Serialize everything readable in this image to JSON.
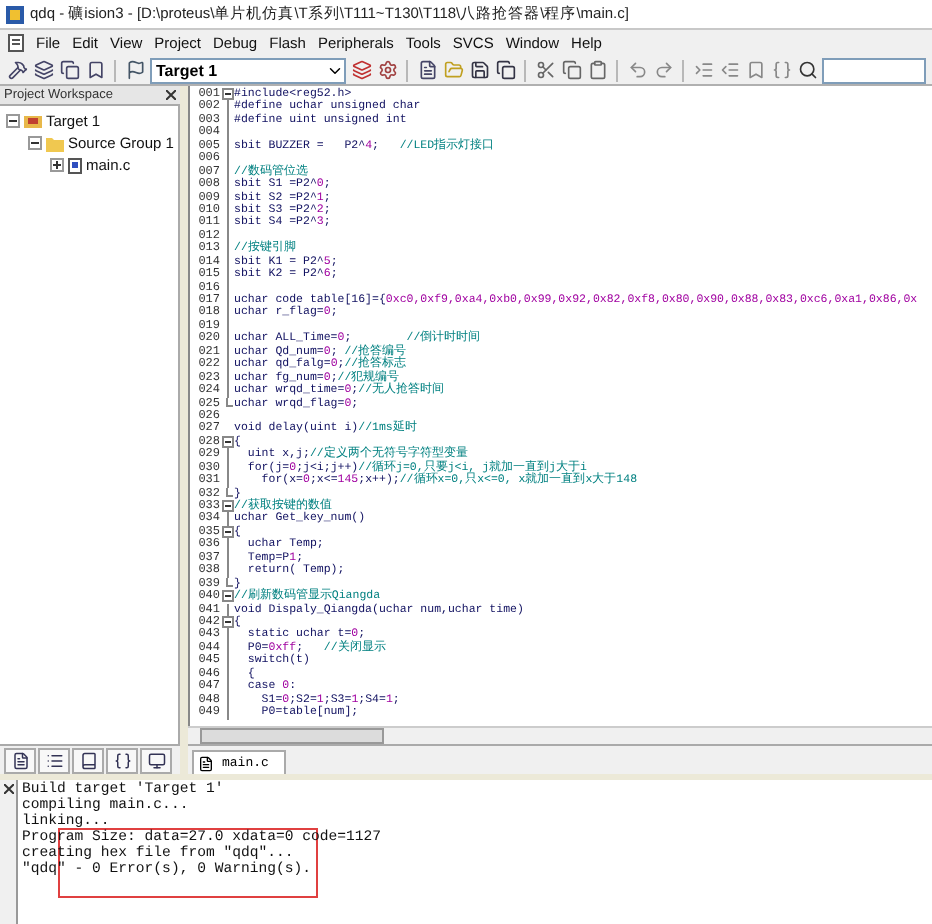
{
  "window": {
    "title": "qdq - 礦ision3 - [D:\\proteus\\单片机仿真\\T系列\\T111~T130\\T118\\八路抢答器\\程序\\main.c]"
  },
  "menu": [
    "File",
    "Edit",
    "View",
    "Project",
    "Debug",
    "Flash",
    "Peripherals",
    "Tools",
    "SVCS",
    "Window",
    "Help"
  ],
  "toolbar": {
    "target": "Target 1"
  },
  "workspace": {
    "title": "Project Workspace",
    "tree": [
      {
        "label": "Target 1",
        "kind": "target",
        "expanded": true,
        "children": [
          {
            "label": "Source Group 1",
            "kind": "group",
            "expanded": true,
            "children": [
              {
                "label": "main.c",
                "kind": "file",
                "expanded": false
              }
            ]
          }
        ]
      }
    ]
  },
  "editor": {
    "tabs": [
      {
        "label": "main.c",
        "selected": true
      }
    ],
    "lines": [
      {
        "no": "001",
        "kind": "open",
        "parts": [
          {
            "kind": "code",
            "text": "#include<reg52.h>"
          }
        ]
      },
      {
        "no": "002",
        "kind": "inner",
        "parts": [
          {
            "kind": "code",
            "text": "#define uchar unsigned char"
          }
        ]
      },
      {
        "no": "003",
        "kind": "inner",
        "parts": [
          {
            "kind": "code",
            "text": "#define uint unsigned int"
          }
        ]
      },
      {
        "no": "004",
        "kind": "inner"
      },
      {
        "no": "005",
        "kind": "inner",
        "parts": [
          {
            "kind": "code",
            "text": "sbit BUZZER =   P2^"
          },
          {
            "kind": "number",
            "text": "4"
          },
          {
            "kind": "code",
            "text": ";   "
          },
          {
            "kind": "comment",
            "text": "//LED指示灯接口"
          }
        ]
      },
      {
        "no": "006",
        "kind": "inner"
      },
      {
        "no": "007",
        "kind": "inner",
        "parts": [
          {
            "kind": "comment",
            "text": "//数码管位选"
          }
        ]
      },
      {
        "no": "008",
        "kind": "inner",
        "parts": [
          {
            "kind": "code",
            "text": "sbit S1 =P2^"
          },
          {
            "kind": "number",
            "text": "0"
          },
          {
            "kind": "code",
            "text": ";"
          }
        ]
      },
      {
        "no": "009",
        "kind": "inner",
        "parts": [
          {
            "kind": "code",
            "text": "sbit S2 =P2^"
          },
          {
            "kind": "number",
            "text": "1"
          },
          {
            "kind": "code",
            "text": ";"
          }
        ]
      },
      {
        "no": "010",
        "kind": "inner",
        "parts": [
          {
            "kind": "code",
            "text": "sbit S3 =P2^"
          },
          {
            "kind": "number",
            "text": "2"
          },
          {
            "kind": "code",
            "text": ";"
          }
        ]
      },
      {
        "no": "011",
        "kind": "inner",
        "parts": [
          {
            "kind": "code",
            "text": "sbit S4 =P2^"
          },
          {
            "kind": "number",
            "text": "3"
          },
          {
            "kind": "code",
            "text": ";"
          }
        ]
      },
      {
        "no": "012",
        "kind": "inner"
      },
      {
        "no": "013",
        "kind": "inner",
        "parts": [
          {
            "kind": "comment",
            "text": "//按键引脚"
          }
        ]
      },
      {
        "no": "014",
        "kind": "inner",
        "parts": [
          {
            "kind": "code",
            "text": "sbit K1 = P2^"
          },
          {
            "kind": "number",
            "text": "5"
          },
          {
            "kind": "code",
            "text": ";"
          }
        ]
      },
      {
        "no": "015",
        "kind": "inner",
        "parts": [
          {
            "kind": "code",
            "text": "sbit K2 = P2^"
          },
          {
            "kind": "number",
            "text": "6"
          },
          {
            "kind": "code",
            "text": ";"
          }
        ]
      },
      {
        "no": "016",
        "kind": "inner"
      },
      {
        "no": "017",
        "kind": "inner",
        "parts": [
          {
            "kind": "code",
            "text": "uchar code table[16]={"
          },
          {
            "kind": "number",
            "text": "0xc0,0xf9,0xa4,0xb0,0x99,0x92,0x82,0xf8,0x80,0x90,0x88,0x83,0xc6,0xa1,0x86,0x"
          }
        ]
      },
      {
        "no": "018",
        "kind": "inner",
        "parts": [
          {
            "kind": "code",
            "text": "uchar r_flag="
          },
          {
            "kind": "number",
            "text": "0"
          },
          {
            "kind": "code",
            "text": ";"
          }
        ]
      },
      {
        "no": "019",
        "kind": "inner"
      },
      {
        "no": "020",
        "kind": "inner",
        "parts": [
          {
            "kind": "code",
            "text": "uchar ALL_Time="
          },
          {
            "kind": "number",
            "text": "0"
          },
          {
            "kind": "code",
            "text": ";        "
          },
          {
            "kind": "comment",
            "text": "//倒计时时间"
          }
        ]
      },
      {
        "no": "021",
        "kind": "inner",
        "parts": [
          {
            "kind": "code",
            "text": "uchar Qd_num="
          },
          {
            "kind": "number",
            "text": "0"
          },
          {
            "kind": "code",
            "text": "; "
          },
          {
            "kind": "comment",
            "text": "//抢答编号"
          }
        ]
      },
      {
        "no": "022",
        "kind": "inner",
        "parts": [
          {
            "kind": "code",
            "text": "uchar qd_falg="
          },
          {
            "kind": "number",
            "text": "0"
          },
          {
            "kind": "code",
            "text": ";"
          },
          {
            "kind": "comment",
            "text": "//抢答标志"
          }
        ]
      },
      {
        "no": "023",
        "kind": "inner",
        "parts": [
          {
            "kind": "code",
            "text": "uchar fg_num="
          },
          {
            "kind": "number",
            "text": "0"
          },
          {
            "kind": "code",
            "text": ";"
          },
          {
            "kind": "comment",
            "text": "//犯规编号"
          }
        ]
      },
      {
        "no": "024",
        "kind": "inner",
        "parts": [
          {
            "kind": "code",
            "text": "uchar wrqd_time="
          },
          {
            "kind": "number",
            "text": "0"
          },
          {
            "kind": "code",
            "text": ";"
          },
          {
            "kind": "comment",
            "text": "//无人抢答时间"
          }
        ]
      },
      {
        "no": "025",
        "kind": "close",
        "parts": [
          {
            "kind": "code",
            "text": "uchar wrqd_flag="
          },
          {
            "kind": "number",
            "text": "0"
          },
          {
            "kind": "code",
            "text": ";"
          }
        ]
      },
      {
        "no": "026",
        "kind": "plain"
      },
      {
        "no": "027",
        "kind": "plain",
        "parts": [
          {
            "kind": "code",
            "text": "void delay(uint i)"
          },
          {
            "kind": "comment",
            "text": "//1ms延时"
          }
        ]
      },
      {
        "no": "028",
        "kind": "open",
        "parts": [
          {
            "kind": "code",
            "text": "{"
          }
        ]
      },
      {
        "no": "029",
        "kind": "inner",
        "parts": [
          {
            "kind": "code",
            "text": "  uint x,j;"
          },
          {
            "kind": "comment",
            "text": "//定义两个无符号字符型变量"
          }
        ]
      },
      {
        "no": "030",
        "kind": "inner",
        "parts": [
          {
            "kind": "code",
            "text": "  for(j="
          },
          {
            "kind": "number",
            "text": "0"
          },
          {
            "kind": "code",
            "text": ";j<i;j++)"
          },
          {
            "kind": "comment",
            "text": "//循环j=0,只要j<i, j就加一直到j大于i"
          }
        ]
      },
      {
        "no": "031",
        "kind": "inner",
        "parts": [
          {
            "kind": "code",
            "text": "    for(x="
          },
          {
            "kind": "number",
            "text": "0"
          },
          {
            "kind": "code",
            "text": ";x<="
          },
          {
            "kind": "number",
            "text": "145"
          },
          {
            "kind": "code",
            "text": ";x++);"
          },
          {
            "kind": "comment",
            "text": "//循环x=0,只x<=0, x就加一直到x大于148"
          }
        ]
      },
      {
        "no": "032",
        "kind": "close",
        "parts": [
          {
            "kind": "code",
            "text": "}"
          }
        ]
      },
      {
        "no": "033",
        "kind": "open",
        "parts": [
          {
            "kind": "comment",
            "text": "//获取按键的数值"
          }
        ]
      },
      {
        "no": "034",
        "kind": "inner",
        "parts": [
          {
            "kind": "code",
            "text": "uchar Get_key_num()"
          }
        ]
      },
      {
        "no": "035",
        "kind": "open",
        "parts": [
          {
            "kind": "code",
            "text": "{"
          }
        ]
      },
      {
        "no": "036",
        "kind": "inner",
        "parts": [
          {
            "kind": "code",
            "text": "  uchar Temp;"
          }
        ]
      },
      {
        "no": "037",
        "kind": "inner",
        "parts": [
          {
            "kind": "code",
            "text": "  Temp=P"
          },
          {
            "kind": "number",
            "text": "1"
          },
          {
            "kind": "code",
            "text": ";"
          }
        ]
      },
      {
        "no": "038",
        "kind": "inner",
        "parts": [
          {
            "kind": "code",
            "text": "  return( Temp);"
          }
        ]
      },
      {
        "no": "039",
        "kind": "close",
        "parts": [
          {
            "kind": "code",
            "text": "}"
          }
        ]
      },
      {
        "no": "040",
        "kind": "open",
        "parts": [
          {
            "kind": "comment",
            "text": "//刷新数码管显示Qiangda"
          }
        ]
      },
      {
        "no": "041",
        "kind": "inner",
        "parts": [
          {
            "kind": "code",
            "text": "void Dispaly_Qiangda(uchar num,uchar time)"
          }
        ]
      },
      {
        "no": "042",
        "kind": "open",
        "parts": [
          {
            "kind": "code",
            "text": "{"
          }
        ]
      },
      {
        "no": "043",
        "kind": "inner",
        "parts": [
          {
            "kind": "code",
            "text": "  static uchar t="
          },
          {
            "kind": "number",
            "text": "0"
          },
          {
            "kind": "code",
            "text": ";"
          }
        ]
      },
      {
        "no": "044",
        "kind": "inner",
        "parts": [
          {
            "kind": "code",
            "text": "  P0="
          },
          {
            "kind": "number",
            "text": "0xff"
          },
          {
            "kind": "code",
            "text": ";   "
          },
          {
            "kind": "comment",
            "text": "//关闭显示"
          }
        ]
      },
      {
        "no": "045",
        "kind": "inner",
        "parts": [
          {
            "kind": "code",
            "text": "  switch(t)"
          }
        ]
      },
      {
        "no": "046",
        "kind": "inner",
        "parts": [
          {
            "kind": "code",
            "text": "  {"
          }
        ]
      },
      {
        "no": "047",
        "kind": "inner",
        "parts": [
          {
            "kind": "code",
            "text": "  case "
          },
          {
            "kind": "number",
            "text": "0"
          },
          {
            "kind": "code",
            "text": ":"
          }
        ]
      },
      {
        "no": "048",
        "kind": "inner",
        "parts": [
          {
            "kind": "code",
            "text": "    S1="
          },
          {
            "kind": "number",
            "text": "0"
          },
          {
            "kind": "code",
            "text": ";S2="
          },
          {
            "kind": "number",
            "text": "1"
          },
          {
            "kind": "code",
            "text": ";S3="
          },
          {
            "kind": "number",
            "text": "1"
          },
          {
            "kind": "code",
            "text": ";S4="
          },
          {
            "kind": "number",
            "text": "1"
          },
          {
            "kind": "code",
            "text": ";"
          }
        ]
      },
      {
        "no": "049",
        "kind": "inner",
        "parts": [
          {
            "kind": "code",
            "text": "    P0=table[num];"
          }
        ]
      }
    ]
  },
  "output": {
    "lines": [
      "Build target 'Target 1'",
      "compiling main.c...",
      "linking...",
      "Program Size: data=27.0 xdata=0 code=1127",
      "creating hex file from \"qdq\"...",
      "\"qdq\" - 0 Error(s), 0 Warning(s)."
    ]
  }
}
